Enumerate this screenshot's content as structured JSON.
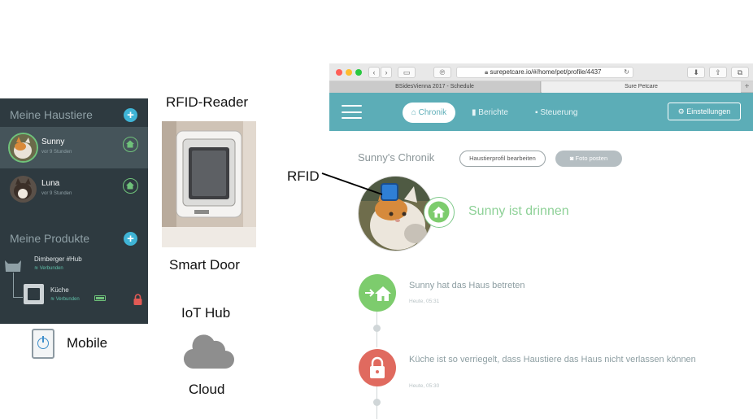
{
  "mobile": {
    "pets_header": "Meine Haustiere",
    "pets": [
      {
        "name": "Sunny",
        "sub": "vor 9 Stunden"
      },
      {
        "name": "Luna",
        "sub": "vor 9 Stunden"
      }
    ],
    "products_header": "Meine Produkte",
    "hub": {
      "name": "Dimberger #Hub",
      "status": "Verbunden"
    },
    "door": {
      "name": "Küche",
      "status": "Verbunden"
    }
  },
  "captions": {
    "rfid_reader": "RFID-Reader",
    "smart_door": "Smart Door",
    "iot_hub": "IoT Hub",
    "cloud": "Cloud",
    "mobile": "Mobile",
    "rfid": "RFID"
  },
  "browser": {
    "url": "surepetcare.io/#/home/pet/profile/4437",
    "tabs": [
      "BSidesVienna 2017 - Schedule",
      "Sure Petcare"
    ],
    "nav": {
      "chronik": "Chronik",
      "berichte": "Berichte",
      "steuerung": "Steuerung",
      "settings": "Einstellungen"
    },
    "page_title": "Sunny's Chronik",
    "edit_profile": "Haustierprofil bearbeiten",
    "post_photo": "Foto posten",
    "status": "Sunny ist drinnen",
    "events": [
      {
        "text": "Sunny hat das Haus betreten",
        "time": "Heute, 05:31",
        "color": "#7dcc6d"
      },
      {
        "text": "Küche ist so verriegelt, dass Haustiere das Haus nicht verlassen können",
        "time": "Heute, 05:30",
        "color": "#e06a5f"
      }
    ]
  },
  "colors": {
    "accent": "#5cadb7",
    "app_bg": "#2e3a40",
    "green": "#7dcc6d",
    "red": "#e06a5f"
  }
}
